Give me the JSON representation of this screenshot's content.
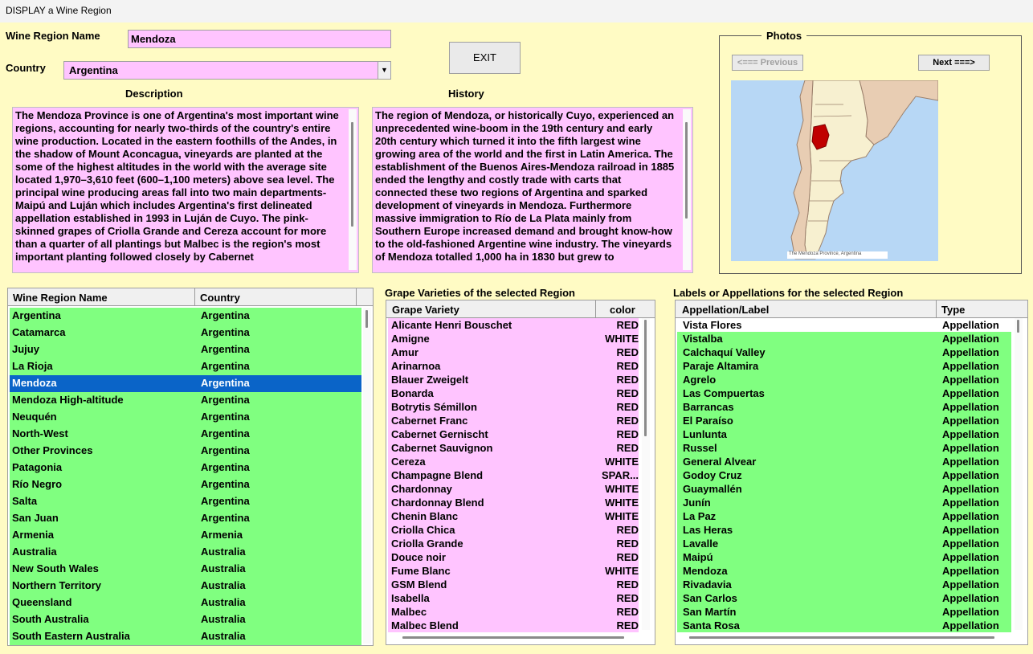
{
  "window": {
    "title": "DISPLAY a Wine Region"
  },
  "form": {
    "region_label": "Wine Region Name",
    "region_value": "Mendoza",
    "country_label": "Country",
    "country_value": "Argentina",
    "exit_label": "EXIT",
    "description_label": "Description",
    "history_label": "History",
    "description_text": "The Mendoza Province is one of Argentina's most important wine regions, accounting for nearly two-thirds of the country's entire wine production. Located in the eastern foothills of the Andes, in the shadow of Mount Aconcagua, vineyards are planted at the some of the highest altitudes in the world with the average site located 1,970–3,610 feet (600–1,100 meters) above sea level. The principal wine producing areas fall into two main departments-Maipú and Luján which includes Argentina's first delineated appellation established in 1993 in Luján de Cuyo. The pink-skinned grapes of Criolla Grande and Cereza account for more than a quarter of all plantings but Malbec is the region's most important planting followed closely by Cabernet",
    "history_text": "The region of Mendoza, or historically Cuyo, experienced an unprecedented wine-boom in the 19th century and early 20th century which turned it into the fifth largest wine growing area of the world and the first in Latin America. The establishment of the Buenos Aires-Mendoza railroad in 1885 ended the lengthy and costly trade with carts that connected these two regions of Argentina and sparked development of vineyards in Mendoza. Furthermore massive immigration to Río de La Plata mainly from Southern Europe increased demand and brought know-how to the old-fashioned Argentine wine industry. The vineyards of Mendoza totalled 1,000 ha in 1830 but grew to"
  },
  "photos": {
    "title": "Photos",
    "prev_label": "<=== Previous",
    "next_label": "Next ===>",
    "caption": "The Mendoza Province, Argentina"
  },
  "regions_grid": {
    "col1": "Wine Region Name",
    "col2": "Country",
    "rows": [
      {
        "name": "Argentina",
        "country": "Argentina"
      },
      {
        "name": "Catamarca",
        "country": "Argentina"
      },
      {
        "name": "Jujuy",
        "country": "Argentina"
      },
      {
        "name": "La Rioja",
        "country": "Argentina"
      },
      {
        "name": "Mendoza",
        "country": "Argentina",
        "selected": true
      },
      {
        "name": "Mendoza High-altitude",
        "country": "Argentina"
      },
      {
        "name": "Neuquén",
        "country": "Argentina"
      },
      {
        "name": "North-West",
        "country": "Argentina"
      },
      {
        "name": "Other Provinces",
        "country": "Argentina"
      },
      {
        "name": "Patagonia",
        "country": "Argentina"
      },
      {
        "name": "Río Negro",
        "country": "Argentina"
      },
      {
        "name": "Salta",
        "country": "Argentina"
      },
      {
        "name": "San Juan",
        "country": "Argentina"
      },
      {
        "name": "Armenia",
        "country": "Armenia"
      },
      {
        "name": "Australia",
        "country": "Australia"
      },
      {
        "name": "New South Wales",
        "country": "Australia"
      },
      {
        "name": "Northern Territory",
        "country": "Australia"
      },
      {
        "name": "Queensland",
        "country": "Australia"
      },
      {
        "name": "South Australia",
        "country": "Australia"
      },
      {
        "name": "South Eastern Australia",
        "country": "Australia"
      }
    ]
  },
  "grapes_grid": {
    "title": "Grape Varieties of the selected Region",
    "col1": "Grape Variety",
    "col2": "color",
    "rows": [
      {
        "name": "Alicante Henri Bouschet",
        "color": "RED"
      },
      {
        "name": "Amigne",
        "color": "WHITE"
      },
      {
        "name": "Amur",
        "color": "RED"
      },
      {
        "name": "Arinarnoa",
        "color": "RED"
      },
      {
        "name": "Blauer Zweigelt",
        "color": "RED"
      },
      {
        "name": "Bonarda",
        "color": "RED"
      },
      {
        "name": "Botrytis Sémillon",
        "color": "RED"
      },
      {
        "name": "Cabernet Franc",
        "color": "RED"
      },
      {
        "name": "Cabernet Gernischt",
        "color": "RED"
      },
      {
        "name": "Cabernet Sauvignon",
        "color": "RED"
      },
      {
        "name": "Cereza",
        "color": "WHITE"
      },
      {
        "name": "Champagne Blend",
        "color": "SPAR..."
      },
      {
        "name": "Chardonnay",
        "color": "WHITE"
      },
      {
        "name": "Chardonnay Blend",
        "color": "WHITE"
      },
      {
        "name": "Chenin Blanc",
        "color": "WHITE"
      },
      {
        "name": "Criolla Chica",
        "color": "RED"
      },
      {
        "name": "Criolla Grande",
        "color": "RED"
      },
      {
        "name": "Douce noir",
        "color": "RED"
      },
      {
        "name": "Fume Blanc",
        "color": "WHITE"
      },
      {
        "name": "GSM Blend",
        "color": "RED"
      },
      {
        "name": "Isabella",
        "color": "RED"
      },
      {
        "name": "Malbec",
        "color": "RED"
      },
      {
        "name": "Malbec Blend",
        "color": "RED"
      }
    ]
  },
  "labels_grid": {
    "title": "Labels or Appellations  for the selected Region",
    "col1": "Appellation/Label",
    "col2": "Type",
    "rows": [
      {
        "name": "Vista Flores",
        "type": "Appellation",
        "first": true
      },
      {
        "name": "Vistalba",
        "type": "Appellation"
      },
      {
        "name": "Calchaquí Valley",
        "type": "Appellation"
      },
      {
        "name": "Paraje Altamira",
        "type": "Appellation"
      },
      {
        "name": "Agrelo",
        "type": "Appellation"
      },
      {
        "name": "Las Compuertas",
        "type": "Appellation"
      },
      {
        "name": "Barrancas",
        "type": "Appellation"
      },
      {
        "name": "El Paraíso",
        "type": "Appellation"
      },
      {
        "name": "Lunlunta",
        "type": "Appellation"
      },
      {
        "name": "Russel",
        "type": "Appellation"
      },
      {
        "name": "General Alvear",
        "type": "Appellation"
      },
      {
        "name": "Godoy Cruz",
        "type": "Appellation"
      },
      {
        "name": "Guaymallén",
        "type": "Appellation"
      },
      {
        "name": "Junín",
        "type": "Appellation"
      },
      {
        "name": "La Paz",
        "type": "Appellation"
      },
      {
        "name": "Las Heras",
        "type": "Appellation"
      },
      {
        "name": "Lavalle",
        "type": "Appellation"
      },
      {
        "name": "Maipú",
        "type": "Appellation"
      },
      {
        "name": "Mendoza",
        "type": "Appellation"
      },
      {
        "name": "Rivadavia",
        "type": "Appellation"
      },
      {
        "name": "San Carlos",
        "type": "Appellation"
      },
      {
        "name": "San Martín",
        "type": "Appellation"
      },
      {
        "name": "Santa Rosa",
        "type": "Appellation"
      }
    ]
  },
  "colors": {
    "background": "#fffbc4",
    "field": "#ffc4ff",
    "region_row": "#80ff80",
    "selected_row": "#0a64c8"
  }
}
